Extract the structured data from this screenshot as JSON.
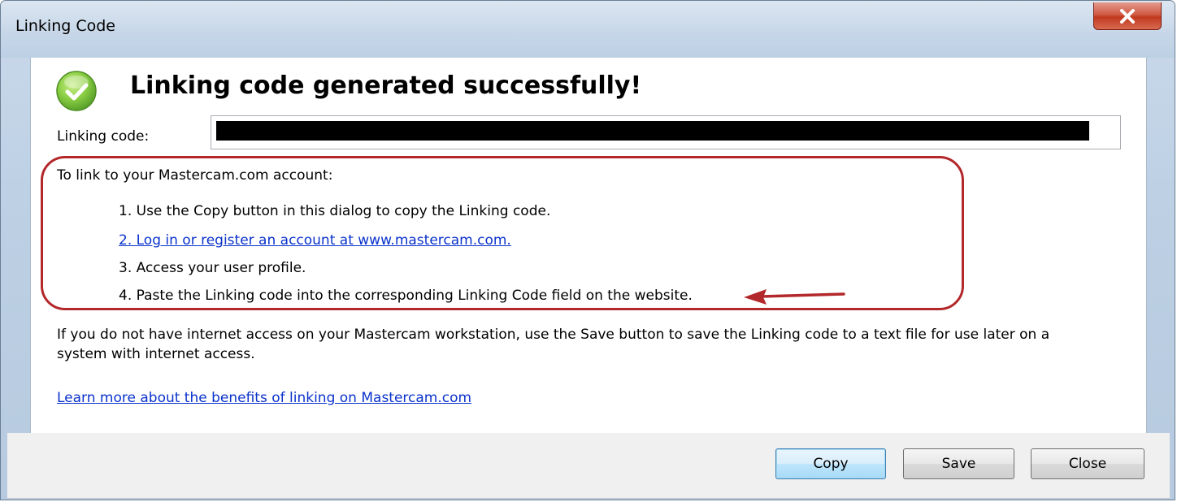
{
  "window": {
    "title": "Linking Code",
    "close_icon": "close-x-icon"
  },
  "header": {
    "icon": "checkmark-success-icon",
    "headline": "Linking code generated successfully!"
  },
  "linking_code": {
    "label": "Linking code:",
    "value_redacted": true
  },
  "instructions": {
    "intro": "To link to your Mastercam.com account:",
    "steps": [
      "1. Use the Copy button in this dialog to copy the Linking code.",
      "2. Log in or register an account at www.mastercam.com.",
      "3. Access your user profile.",
      "4. Paste the Linking code into the corresponding Linking Code field on the website."
    ]
  },
  "note": "If you do not have internet access on your Mastercam workstation, use the Save button to save the Linking code to a text file for use later on a system with internet access.",
  "learn_more_link": "Learn more about the benefits of linking on Mastercam.com",
  "buttons": {
    "copy": "Copy",
    "save": "Save",
    "close": "Close"
  },
  "colors": {
    "link": "#0b33cc",
    "annotation": "#b3282a",
    "success_green": "#7cc242"
  }
}
